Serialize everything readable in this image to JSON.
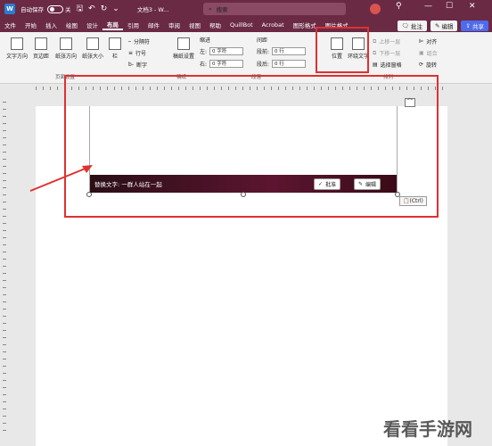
{
  "titlebar": {
    "autosave_label": "自动保存",
    "autosave_state": "关",
    "doc_title": "文档3 - W...",
    "search_placeholder": "搜索",
    "minimize": "—",
    "maximize": "☐",
    "close": "✕"
  },
  "menu": {
    "tabs": [
      "文件",
      "开始",
      "插入",
      "绘图",
      "设计",
      "布局",
      "引用",
      "邮件",
      "审阅",
      "视图",
      "帮助",
      "QuillBot",
      "Acrobat",
      "图形格式",
      "图片格式"
    ],
    "comment_label": "批注",
    "edit_label": "编辑",
    "share_label": "共享"
  },
  "ribbon": {
    "text_direction": "文字方向",
    "margins": "页边距",
    "orientation": "纸张方向",
    "size": "纸张大小",
    "columns": "栏",
    "breaks": "分隔符",
    "line_numbers": "行号",
    "hyphenation": "断字",
    "draft_settings": "稿纸设置",
    "indent_label": "缩进",
    "spacing_label": "间距",
    "indent_left_label": "左:",
    "indent_left_value": "0 字符",
    "indent_right_label": "右:",
    "indent_right_value": "0 字符",
    "space_before_label": "段前:",
    "space_before_value": "0 行",
    "space_after_label": "段后:",
    "space_after_value": "0 行",
    "position": "位置",
    "wrap_text": "环绕文字",
    "bring_forward": "上移一层",
    "send_backward": "下移一层",
    "selection_pane": "选择窗格",
    "align": "对齐",
    "group": "组合",
    "rotate": "旋转",
    "group_page_setup": "页面设置",
    "group_draft": "稿纸",
    "group_paragraph": "段落",
    "group_arrange": "排列"
  },
  "document": {
    "alt_text_caption": "替换文字: 一群人站在一起",
    "approve_label": "批准",
    "edit_label": "编辑",
    "paste_ctrl_label": "(Ctrl)"
  },
  "watermark": "看看手游网",
  "colors": {
    "title_bar": "#6a2a44",
    "highlight_box": "#e03030",
    "share_button": "#4f6bed"
  }
}
